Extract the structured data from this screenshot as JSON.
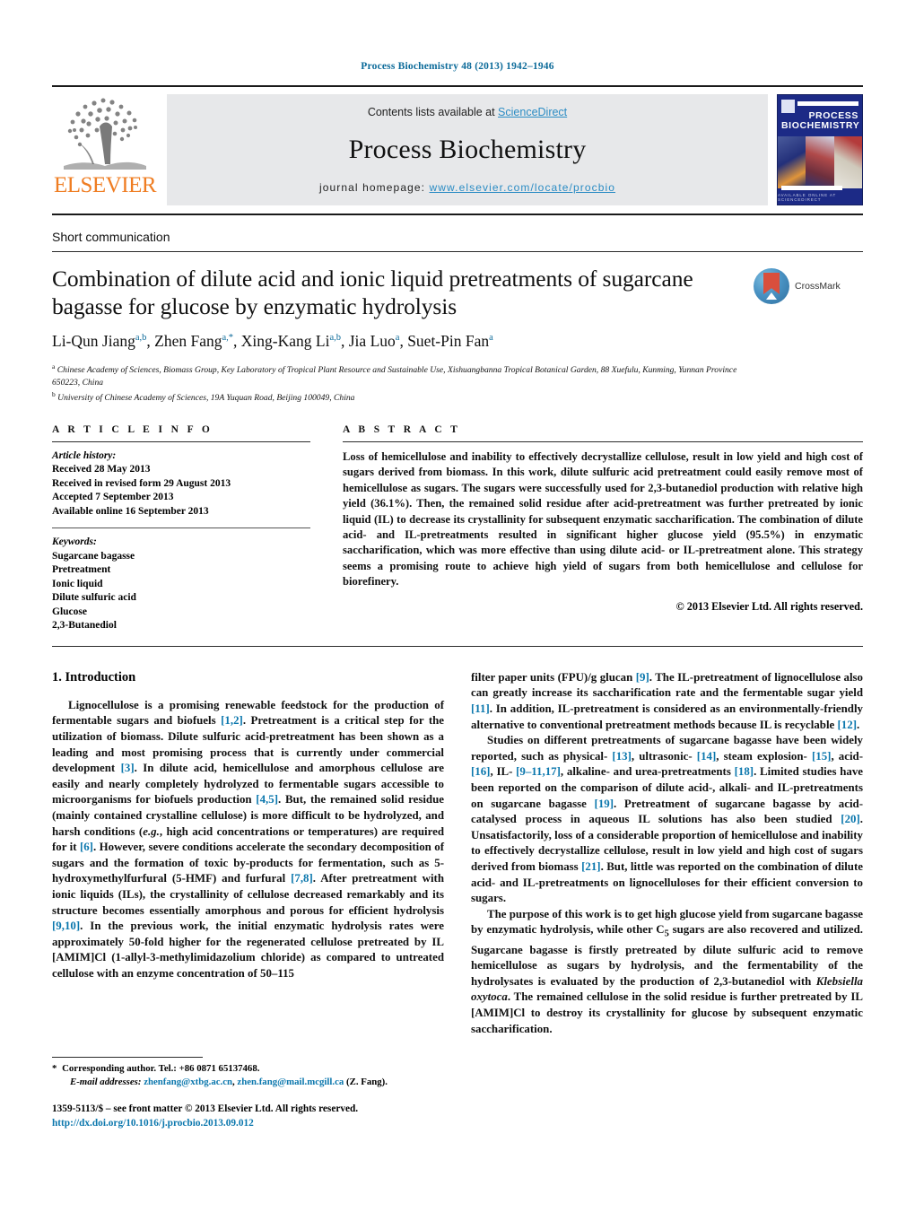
{
  "running_head": "Process Biochemistry 48 (2013) 1942–1946",
  "masthead": {
    "contents_prefix": "Contents lists available at ",
    "sciencedirect": "ScienceDirect",
    "journal_name": "Process Biochemistry",
    "homepage_prefix": "journal homepage: ",
    "homepage_url": "www.elsevier.com/locate/procbio",
    "publisher_logo_text": "ELSEVIER",
    "cover_title_line1": "PROCESS",
    "cover_title_line2": "BIOCHEMISTRY",
    "cover_footer": "AVAILABLE ONLINE AT SCIENCEDIRECT",
    "band_color": "#e7e8ea",
    "link_color": "#2b8cc4",
    "elsevier_orange": "#ef7d22",
    "cover_blue": "#1c2a86"
  },
  "article": {
    "kind": "Short communication",
    "title": "Combination of dilute acid and ionic liquid pretreatments of sugarcane bagasse for glucose by enzymatic hydrolysis",
    "authors_html": "Li-Qun Jiang<sup>a,b</sup>, Zhen Fang<sup>a,*</sup>, Xing-Kang Li<sup>a,b</sup>, Jia Luo<sup>a</sup>, Suet-Pin Fan<sup>a</sup>",
    "affiliation_a": "Chinese Academy of Sciences, Biomass Group, Key Laboratory of Tropical Plant Resource and Sustainable Use, Xishuangbanna Tropical Botanical Garden, 88 Xuefulu, Kunming, Yunnan Province 650223, China",
    "affiliation_b": "University of Chinese Academy of Sciences, 19A Yuquan Road, Beijing 100049, China",
    "crossmark_label": "CrossMark",
    "superscript_color": "#0b6a99"
  },
  "article_info": {
    "heading": "A R T I C L E    I N F O",
    "history_label": "Article history:",
    "history": [
      "Received 28 May 2013",
      "Received in revised form 29 August 2013",
      "Accepted 7 September 2013",
      "Available online 16 September 2013"
    ],
    "keywords_label": "Keywords:",
    "keywords": [
      "Sugarcane bagasse",
      "Pretreatment",
      "Ionic liquid",
      "Dilute sulfuric acid",
      "Glucose",
      "2,3-Butanediol"
    ]
  },
  "abstract": {
    "heading": "A B S T R A C T",
    "text": "Loss of hemicellulose and inability to effectively decrystallize cellulose, result in low yield and high cost of sugars derived from biomass. In this work, dilute sulfuric acid pretreatment could easily remove most of hemicellulose as sugars. The sugars were successfully used for 2,3-butanediol production with relative high yield (36.1%). Then, the remained solid residue after acid-pretreatment was further pretreated by ionic liquid (IL) to decrease its crystallinity for subsequent enzymatic saccharification. The combination of dilute acid- and IL-pretreatments resulted in significant higher glucose yield (95.5%) in enzymatic saccharification, which was more effective than using dilute acid- or IL-pretreatment alone. This strategy seems a promising route to achieve high yield of sugars from both hemicellulose and cellulose for biorefinery.",
    "rights": "© 2013 Elsevier Ltd. All rights reserved."
  },
  "introduction": {
    "heading": "1. Introduction",
    "left_paragraph_1_html": "Lignocellulose is a promising renewable feedstock for the production of fermentable sugars and biofuels <span class=\"ref\">[1,2]</span>. Pretreatment is a critical step for the utilization of biomass. Dilute sulfuric acid-pretreatment has been shown as a leading and most promising process that is currently under commercial development <span class=\"ref\">[3]</span>. In dilute acid, hemicellulose and amorphous cellulose are easily and nearly completely hydrolyzed to fermentable sugars accessible to microorganisms for biofuels production <span class=\"ref\">[4,5]</span>. But, the remained solid residue (mainly contained crystalline cellulose) is more difficult to be hydrolyzed, and harsh conditions (<i>e.g.</i>, high acid concentrations or temperatures) are required for it <span class=\"ref\">[6]</span>. However, severe conditions accelerate the secondary decomposition of sugars and the formation of toxic by-products for fermentation, such as 5-hydroxymethylfurfural (5-HMF) and furfural <span class=\"ref\">[7,8]</span>. After pretreatment with ionic liquids (ILs), the crystallinity of cellulose decreased remarkably and its structure becomes essentially amorphous and porous for efficient hydrolysis <span class=\"ref\">[9,10]</span>. In the previous work, the initial enzymatic hydrolysis rates were approximately 50-fold higher for the regenerated cellulose pretreated by IL [AMIM]Cl (1-allyl-3-methylimidazolium chloride) as compared to untreated cellulose with an enzyme concentration of 50–115",
    "right_paragraph_1_html": "filter paper units (FPU)/g glucan <span class=\"ref\">[9]</span>. The IL-pretreatment of lignocellulose also can greatly increase its saccharification rate and the fermentable sugar yield <span class=\"ref\">[11]</span>. In addition, IL-pretreatment is considered as an environmentally-friendly alternative to conventional pretreatment methods because IL is recyclable <span class=\"ref\">[12]</span>.",
    "right_paragraph_2_html": "Studies on different pretreatments of sugarcane bagasse have been widely reported, such as physical- <span class=\"ref\">[13]</span>, ultrasonic- <span class=\"ref\">[14]</span>, steam explosion- <span class=\"ref\">[15]</span>, acid- <span class=\"ref\">[16]</span>, IL- <span class=\"ref\">[9–11,17]</span>, alkaline- and urea-pretreatments <span class=\"ref\">[18]</span>. Limited studies have been reported on the comparison of dilute acid-, alkali- and IL-pretreatments on sugarcane bagasse <span class=\"ref\">[19]</span>. Pretreatment of sugarcane bagasse by acid-catalysed process in aqueous IL solutions has also been studied <span class=\"ref\">[20]</span>. Unsatisfactorily, loss of a considerable proportion of hemicellulose and inability to effectively decrystallize cellulose, result in low yield and high cost of sugars derived from biomass <span class=\"ref\">[21]</span>. But, little was reported on the combination of dilute acid- and IL-pretreatments on lignocelluloses for their efficient conversion to sugars.",
    "right_paragraph_3_html": "The purpose of this work is to get high glucose yield from sugarcane bagasse by enzymatic hydrolysis, while other C<sub>5</sub> sugars are also recovered and utilized. Sugarcane bagasse is firstly pretreated by dilute sulfuric acid to remove hemicellulose as sugars by hydrolysis, and the fermentability of the hydrolysates is evaluated by the production of 2,3-butanediol with <i>Klebsiella oxytoca</i>. The remained cellulose in the solid residue is further pretreated by IL [AMIM]Cl to destroy its crystallinity for glucose by subsequent enzymatic saccharification."
  },
  "footnote": {
    "corresponding_html": "<span class=\"star\">*</span> Corresponding author. Tel.: +86 0871 65137468.",
    "email_html": "<i>E-mail addresses:</i> <span class=\"link\">zhenfang@xtbg.ac.cn</span>, <span class=\"link\">zhen.fang@mail.mcgill.ca</span> (Z. Fang).",
    "issn_line": "1359-5113/$ – see front matter © 2013 Elsevier Ltd. All rights reserved.",
    "doi": "http://dx.doi.org/10.1016/j.procbio.2013.09.012"
  }
}
